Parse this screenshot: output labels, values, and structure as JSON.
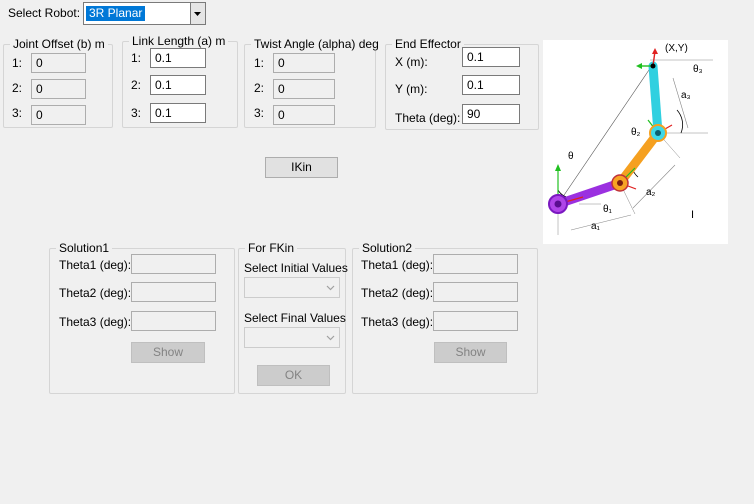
{
  "robot_select": {
    "label": "Select Robot:",
    "value": "3R Planar"
  },
  "joint_offset": {
    "title": "Joint Offset (b) m",
    "rows": [
      "1:",
      "2:",
      "3:"
    ],
    "values": [
      "0",
      "0",
      "0"
    ]
  },
  "link_length": {
    "title": "Link Length (a) m",
    "rows": [
      "1:",
      "2:",
      "3:"
    ],
    "values": [
      "0.1",
      "0.1",
      "0.1"
    ]
  },
  "twist_angle": {
    "title": "Twist Angle (alpha) deg",
    "rows": [
      "1:",
      "2:",
      "3:"
    ],
    "values": [
      "0",
      "0",
      "0"
    ]
  },
  "end_effector": {
    "title": "End Effector",
    "x_label": "X (m):",
    "x_value": "0.1",
    "y_label": "Y (m):",
    "y_value": "0.1",
    "theta_label": "Theta (deg):",
    "theta_value": "90"
  },
  "diagram": {
    "point_label": "(X,Y)",
    "theta3": "θ₃",
    "a3": "a₃",
    "theta2": "θ₂",
    "theta": "θ",
    "a2": "a₂",
    "theta1": "θ₁",
    "a1": "a₁",
    "cursor": "I"
  },
  "ikin_button": "IKin",
  "solution1": {
    "title": "Solution1",
    "theta1_label": "Theta1 (deg):",
    "theta2_label": "Theta2 (deg):",
    "theta3_label": "Theta3 (deg):",
    "show_button": "Show"
  },
  "fkin": {
    "title": "For FKin",
    "initial_label": "Select Initial Values",
    "final_label": "Select Final Values",
    "ok_button": "OK"
  },
  "solution2": {
    "title": "Solution2",
    "theta1_label": "Theta1 (deg):",
    "theta2_label": "Theta2 (deg):",
    "theta3_label": "Theta3 (deg):",
    "show_button": "Show"
  },
  "colors": {
    "link1": "#9b30e0",
    "link2": "#f5a020",
    "link3": "#30d0e0",
    "x_axis": "#e02020",
    "y_axis": "#20c020",
    "selection": "#0078d7"
  }
}
